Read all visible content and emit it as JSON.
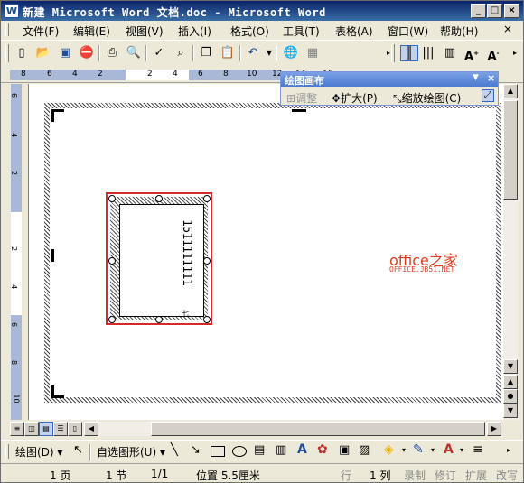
{
  "window": {
    "title": "新建 Microsoft Word 文档.doc - Microsoft Word"
  },
  "menu": [
    "文件(F)",
    "编辑(E)",
    "视图(V)",
    "插入(I)",
    "格式(O)",
    "工具(T)",
    "表格(A)",
    "窗口(W)",
    "帮助(H)"
  ],
  "ruler": {
    "numbers": [
      "8",
      "6",
      "4",
      "2",
      "2",
      "4",
      "6",
      "8",
      "10",
      "12",
      "14",
      "16"
    ]
  },
  "vruler": {
    "numbers": [
      "6",
      "4",
      "2",
      "2",
      "4",
      "6",
      "8",
      "10"
    ]
  },
  "drawing_canvas": {
    "title": "绘图画布",
    "buttons": [
      "调整",
      "扩大(P)",
      "缩放绘图(C)"
    ]
  },
  "textbox": {
    "text": "1511111111",
    "small": "七"
  },
  "watermark": {
    "line1": "office之家",
    "line2": "OFFICE.JB51.NET"
  },
  "drawbar": {
    "draw": "绘图(D)",
    "autoshapes": "自选图形(U)"
  },
  "status": {
    "page": "1 页",
    "section": "1 节",
    "pages": "1/1",
    "position": "位置 5.5厘米",
    "line": "行",
    "col": "1 列",
    "rec": "录制",
    "trk": "修订",
    "ext": "扩展",
    "ovr": "改写"
  },
  "colors": {
    "frame": "#d42a2a",
    "watermark": "#e03c1b",
    "titlebar": "#0a246a"
  }
}
